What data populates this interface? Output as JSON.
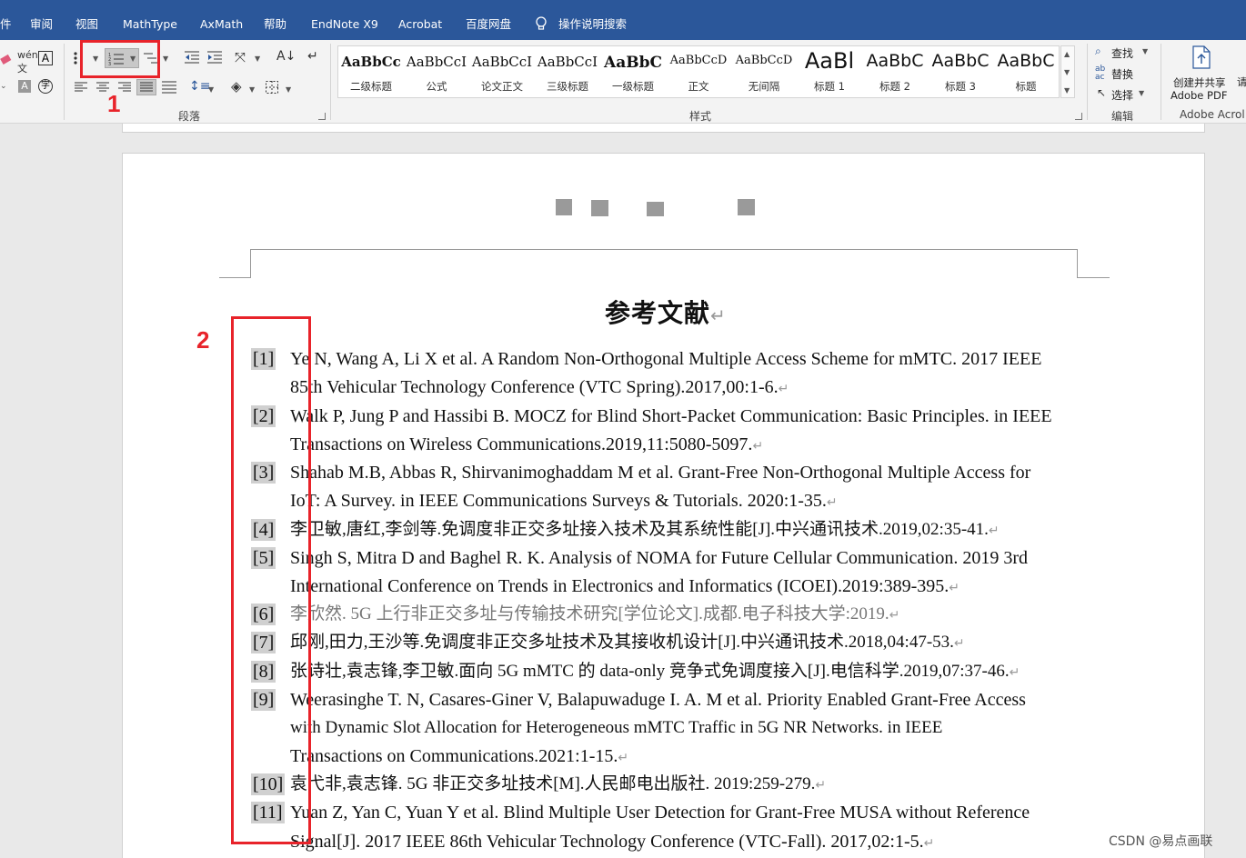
{
  "menubar": {
    "items": [
      "审阅",
      "视图",
      "MathType",
      "AxMath",
      "帮助",
      "EndNote X9",
      "Acrobat",
      "百度网盘"
    ],
    "search_hint": "操作说明搜索"
  },
  "ribbon": {
    "paragraph_group_label": "段落",
    "styles_group_label": "样式",
    "editing_group_label": "编辑",
    "adobe_group_label": "Adobe Acrol",
    "find_label": "查找",
    "replace_label": "替换",
    "select_label": "选择",
    "adobe_button_line1": "创建并共享",
    "adobe_button_line2": "Adobe PDF",
    "styles": [
      {
        "sample": "AaBbCc",
        "name": "二级标题"
      },
      {
        "sample": "AaBbCcI",
        "name": "公式"
      },
      {
        "sample": "AaBbCcI",
        "name": "论文正文"
      },
      {
        "sample": "AaBbCcI",
        "name": "三级标题"
      },
      {
        "sample": "AaBbC",
        "name": "一级标题"
      },
      {
        "sample": "AaBbCcD",
        "name": "正文"
      },
      {
        "sample": "AaBbCcD",
        "name": "无间隔"
      },
      {
        "sample": "AaBl",
        "name": "标题 1"
      },
      {
        "sample": "AaBbC",
        "name": "标题 2"
      },
      {
        "sample": "AaBbC",
        "name": "标题 3"
      },
      {
        "sample": "AaBbC",
        "name": "标题"
      }
    ]
  },
  "document": {
    "title": "参考文献",
    "references": [
      {
        "num": "[1]",
        "lines": [
          "Ye N, Wang A, Li X et al. A Random Non-Orthogonal Multiple Access Scheme for mMTC. 2017 IEEE",
          "85th Vehicular Technology Conference (VTC Spring).2017,00:1-6."
        ]
      },
      {
        "num": "[2]",
        "lines": [
          "Walk P, Jung P and Hassibi B. MOCZ for Blind Short-Packet Communication: Basic Principles. in IEEE",
          "Transactions on Wireless Communications.2019,11:5080-5097."
        ]
      },
      {
        "num": "[3]",
        "lines": [
          "Shahab M.B, Abbas R, Shirvanimoghaddam M et al. Grant-Free Non-Orthogonal Multiple Access for",
          "IoT: A Survey. in IEEE Communications Surveys & Tutorials. 2020:1-35."
        ]
      },
      {
        "num": "[4]",
        "lines": [
          "李卫敏,唐红,李剑等.免调度非正交多址接入技术及其系统性能[J].中兴通讯技术.2019,02:35-41."
        ]
      },
      {
        "num": "[5]",
        "lines": [
          "Singh S, Mitra D and Baghel R. K. Analysis of NOMA for Future Cellular Communication. 2019 3rd",
          "International Conference on Trends in Electronics and Informatics (ICOEI).2019:389-395."
        ]
      },
      {
        "num": "[6]",
        "lines": [
          "李欣然. 5G 上行非正交多址与传输技术研究[学位论文].成都.电子科技大学:2019."
        ]
      },
      {
        "num": "[7]",
        "lines": [
          "邱刚,田力,王沙等.免调度非正交多址技术及其接收机设计[J].中兴通讯技术.2018,04:47-53."
        ]
      },
      {
        "num": "[8]",
        "lines": [
          "张诗壮,袁志锋,李卫敏.面向 5G mMTC 的 data-only 竞争式免调度接入[J].电信科学.2019,07:37-46."
        ]
      },
      {
        "num": "[9]",
        "lines": [
          "Weerasinghe T. N, Casares-Giner V, Balapuwaduge I. A. M et al. Priority Enabled Grant-Free Access",
          "with  Dynamic  Slot  Allocation  for  Heterogeneous  mMTC  Traffic  in  5G  NR  Networks.  in  IEEE",
          "Transactions on Communications.2021:1-15."
        ]
      },
      {
        "num": "[10]",
        "lines": [
          "袁弋非,袁志锋. 5G 非正交多址技术[M].人民邮电出版社. 2019:259-279."
        ]
      },
      {
        "num": "[11]",
        "lines": [
          "Yuan Z, Yan C, Yuan Y et al. Blind Multiple User Detection for Grant-Free MUSA without Reference",
          "Signal[J]. 2017 IEEE 86th Vehicular Technology Conference (VTC-Fall). 2017,02:1-5."
        ]
      }
    ]
  },
  "annotations": {
    "label1": "1",
    "label2": "2"
  },
  "watermark": "CSDN @易点画联",
  "colors": {
    "titlebar": "#2b579a",
    "annotation": "#e8232a",
    "ribbon_bg": "#f3f3f3"
  }
}
